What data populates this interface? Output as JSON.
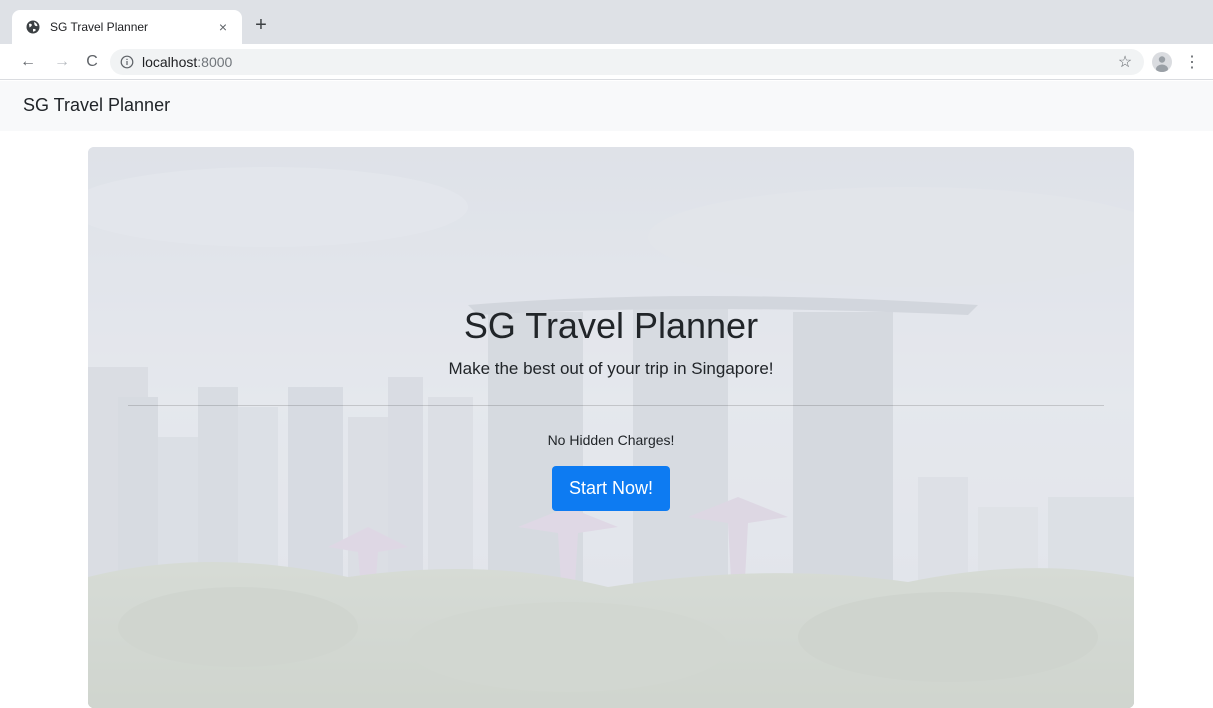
{
  "browser": {
    "tab_title": "SG Travel Planner",
    "tab_close": "×",
    "new_tab": "+",
    "url_host": "localhost",
    "url_port": ":8000",
    "back": "←",
    "forward": "→",
    "reload": "C",
    "star": "☆",
    "menu": "⋮"
  },
  "navbar": {
    "brand": "SG Travel Planner"
  },
  "hero": {
    "title": "SG Travel Planner",
    "lead": "Make the best out of your trip in Singapore!",
    "note": "No Hidden Charges!",
    "cta_label": "Start Now!"
  },
  "colors": {
    "primary": "#0d7bf2",
    "navbar_bg": "#f8f9fa"
  }
}
